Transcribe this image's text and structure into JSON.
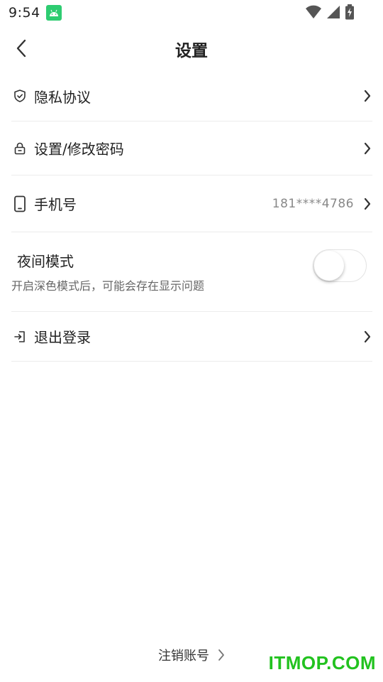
{
  "status_bar": {
    "time": "9:54",
    "icons": [
      "android-icon",
      "wifi-icon",
      "signal-icon",
      "battery-icon"
    ]
  },
  "header": {
    "title": "设置",
    "back_icon": "chevron-left-icon"
  },
  "settings": {
    "privacy": {
      "label": "隐私协议",
      "icon": "shield-icon"
    },
    "password": {
      "label": "设置/修改密码",
      "icon": "lock-icon"
    },
    "phone": {
      "label": "手机号",
      "value": "181****4786",
      "icon": "phone-icon"
    },
    "night_mode": {
      "label": "夜间模式",
      "description": "开启深色模式后，可能会存在显示问题",
      "enabled": false
    },
    "logout": {
      "label": "退出登录",
      "icon": "logout-icon"
    }
  },
  "footer": {
    "cancel_account": "注销账号"
  },
  "watermark": "ITMOP.COM",
  "colors": {
    "android_badge": "#2ecc71",
    "watermark": "#22c21f",
    "divider": "#ececec"
  }
}
